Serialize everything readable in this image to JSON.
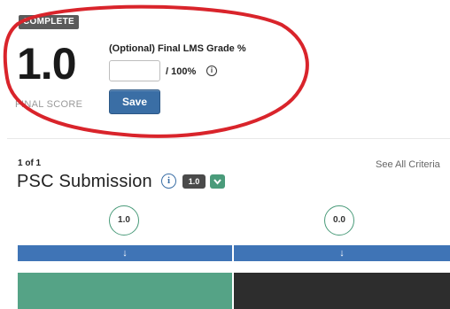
{
  "status_badge": "COMPLETE",
  "score": {
    "value": "1.0",
    "label": "FINAL SCORE"
  },
  "lms": {
    "label": "(Optional) Final LMS Grade %",
    "input_value": "",
    "suffix": "/ 100%",
    "info_glyph": "i",
    "save_label": "Save"
  },
  "criteria": {
    "count": "1 of 1",
    "see_all": "See All Criteria",
    "title": "PSC Submission",
    "info_glyph": "i",
    "score": "1.0",
    "levels": [
      {
        "score": "1.0",
        "arrow": "↓",
        "color": "#55a386"
      },
      {
        "score": "0.0",
        "arrow": "↓",
        "color": "#2d2d2d"
      }
    ]
  },
  "colors": {
    "accent_blue": "#3f74b6",
    "accent_green": "#4a9b7a",
    "annotation_red": "#d9242b"
  },
  "icons": {
    "info": "info-icon",
    "chevron": "chevron-down-icon",
    "arrow": "arrow-down-icon"
  }
}
